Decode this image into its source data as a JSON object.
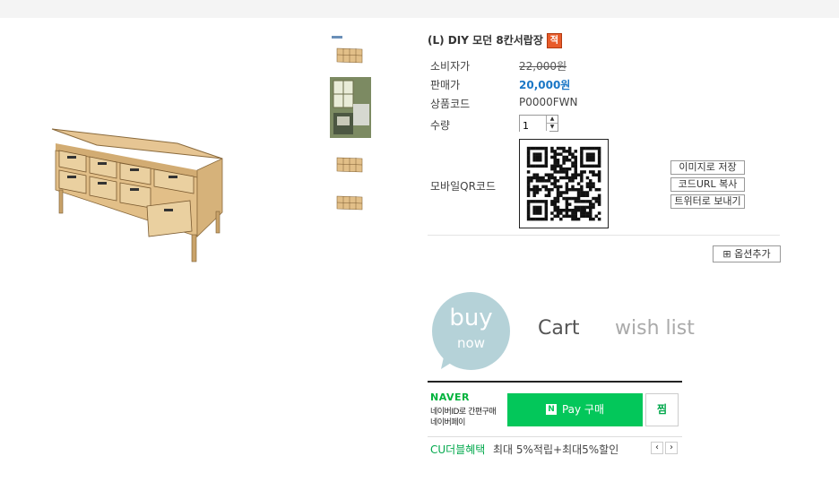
{
  "product": {
    "title": "(L) DIY 모던 8칸서랍장",
    "badge": "적"
  },
  "info": {
    "consumer_price_label": "소비자가",
    "consumer_price": "22,000원",
    "sale_price_label": "판매가",
    "sale_price": "20,000원",
    "code_label": "상품코드",
    "code": "P0000FWN",
    "qty_label": "수량",
    "qty_value": "1",
    "qr_label": "모바일QR코드"
  },
  "qr_actions": {
    "save_image": "이미지로 저장",
    "copy_url": "코드URL 복사",
    "twitter": "트위터로 보내기"
  },
  "options": {
    "add_option": "옵션추가"
  },
  "actions": {
    "buy": "buy",
    "buy_sub": "now",
    "cart": "Cart",
    "wishlist": "wish list"
  },
  "naver": {
    "logo": "NAVER",
    "line1": "네이버ID로 간편구매",
    "line2": "네이버페이",
    "pay_n": "N",
    "pay_label": "Pay 구매",
    "zzim": "찜"
  },
  "cu": {
    "label": "CU더블혜택",
    "desc": "최대 5%적립+최대5%할인",
    "prev": "‹",
    "next": "›"
  },
  "colors": {
    "price_blue": "#1b77c6",
    "naver_green": "#03c75a",
    "buy_circle": "#b5d2d8"
  }
}
